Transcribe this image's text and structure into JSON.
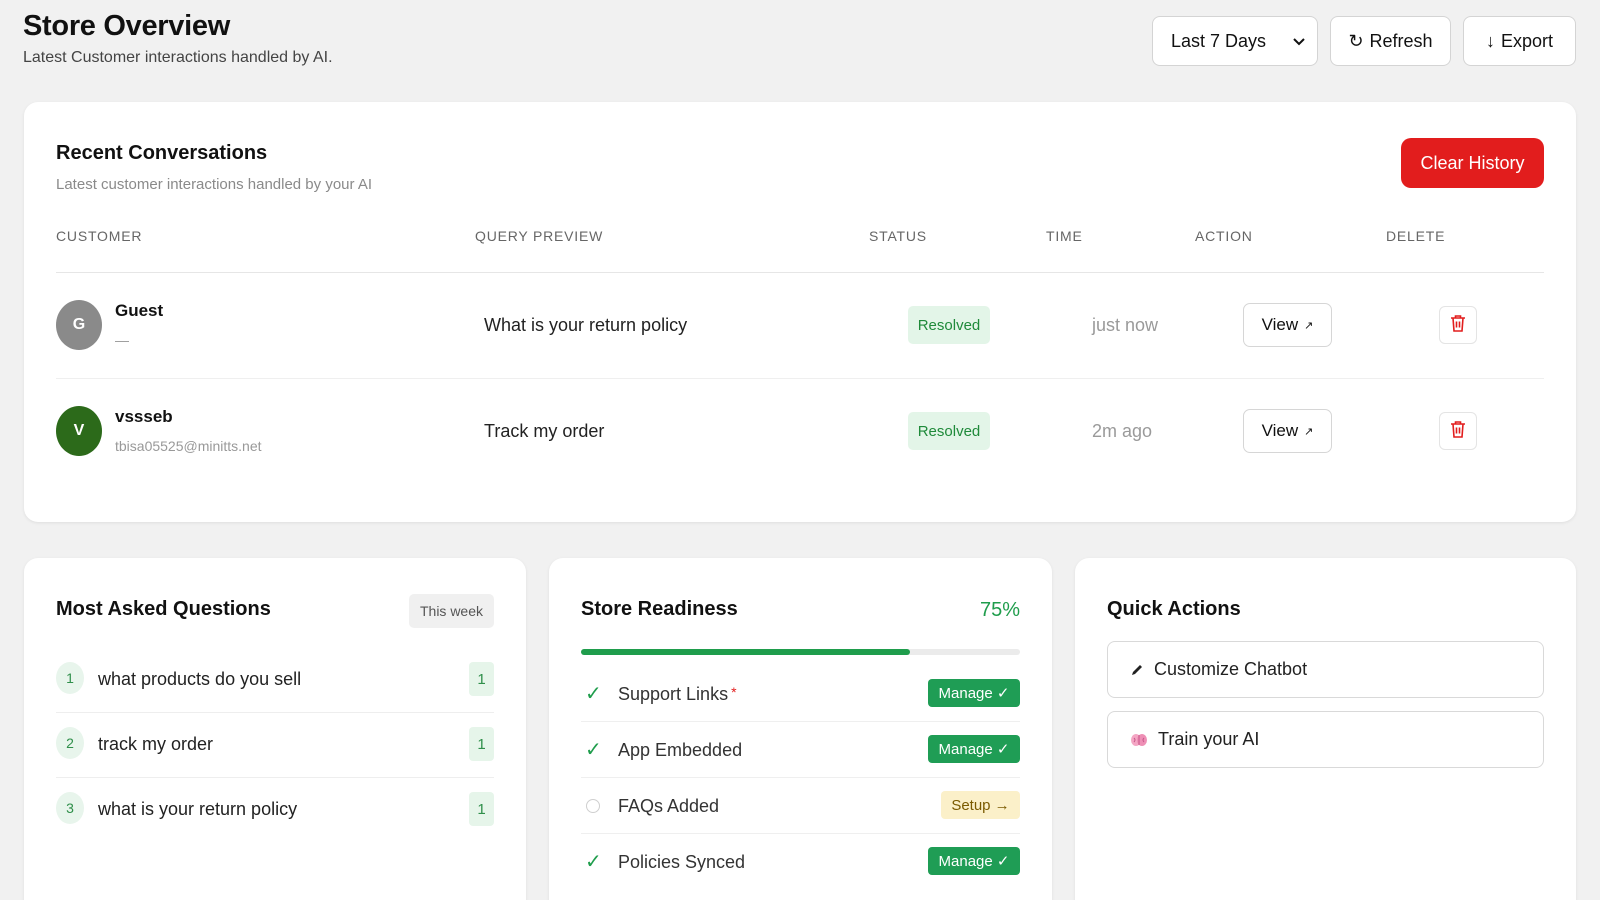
{
  "header": {
    "title": "Store Overview",
    "subtitle": "Latest Customer interactions handled by AI.",
    "date_range": "Last 7 Days",
    "refresh_label": "Refresh",
    "export_label": "Export"
  },
  "conversations": {
    "title": "Recent Conversations",
    "subtitle": "Latest customer interactions handled by your AI",
    "clear_label": "Clear History",
    "columns": [
      "CUSTOMER",
      "QUERY PREVIEW",
      "STATUS",
      "TIME",
      "ACTION",
      "DELETE"
    ],
    "rows": [
      {
        "initial": "G",
        "name": "Guest",
        "email": "—",
        "query": "What is your return policy",
        "status": "Resolved",
        "time": "just now",
        "action": "View",
        "avatar_color": "#8a8a8a"
      },
      {
        "initial": "V",
        "name": "vssseb",
        "email": "tbisa05525@minitts.net",
        "query": "Track my order",
        "status": "Resolved",
        "time": "2m ago",
        "action": "View",
        "avatar_color": "#2c6a1a"
      }
    ]
  },
  "faq": {
    "title": "Most Asked Questions",
    "badge": "This week",
    "items": [
      {
        "num": "1",
        "text": "what products do you sell",
        "count": "1"
      },
      {
        "num": "2",
        "text": "track my order",
        "count": "1"
      },
      {
        "num": "3",
        "text": "what is your return policy",
        "count": "1"
      }
    ]
  },
  "readiness": {
    "title": "Store Readiness",
    "percent_label": "75%",
    "progress_fraction": 0.75,
    "items": [
      {
        "label": "Support Links",
        "done": true,
        "required": "*",
        "action": "Manage ✓"
      },
      {
        "label": "App Embedded",
        "done": true,
        "action": "Manage ✓"
      },
      {
        "label": "FAQs Added",
        "done": false,
        "action": "Setup →"
      },
      {
        "label": "Policies Synced",
        "done": true,
        "action": "Manage ✓"
      }
    ]
  },
  "quick_actions": {
    "title": "Quick Actions",
    "items": [
      {
        "label": "Customize Chatbot",
        "icon": "pencil-icon"
      },
      {
        "label": "Train your AI",
        "icon": "brain-icon"
      }
    ]
  },
  "colors": {
    "danger": "#e21d1d",
    "success": "#1f9d4c",
    "background": "#f1f1f1"
  }
}
